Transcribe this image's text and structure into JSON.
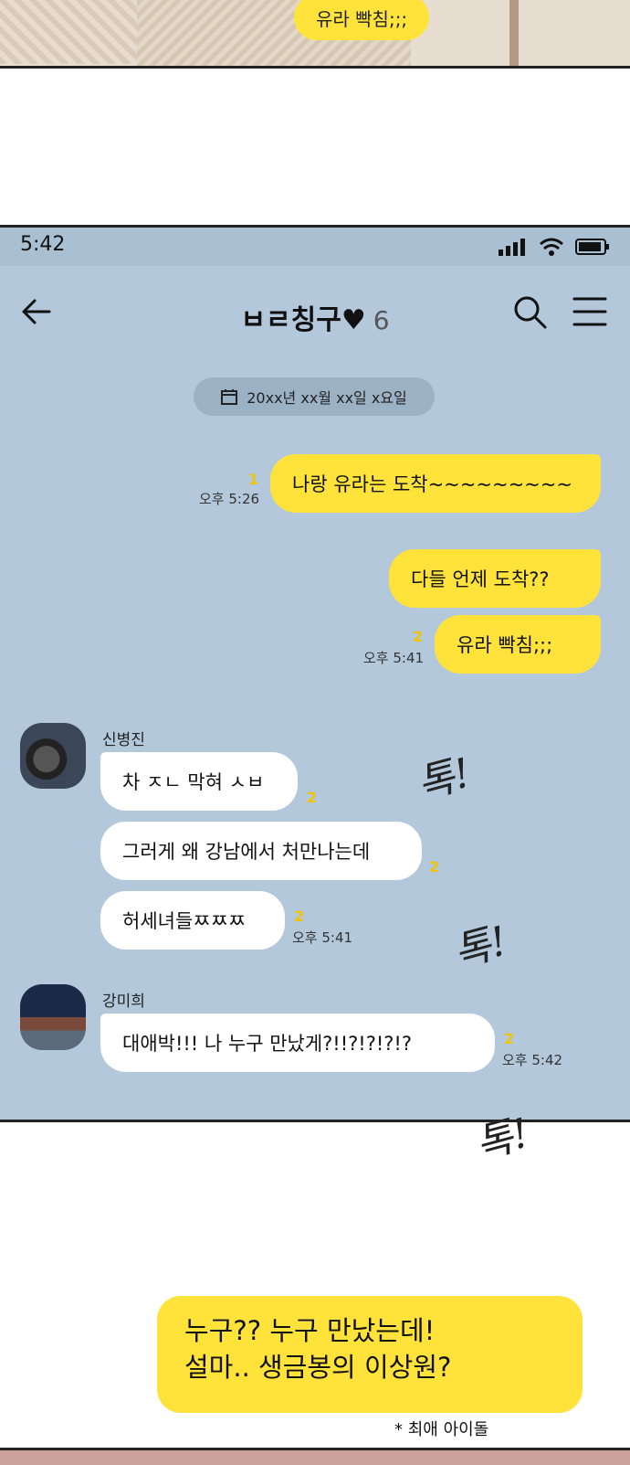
{
  "top_panel": {
    "bubble_text": "유라 빡침;;;"
  },
  "status_bar": {
    "time": "5:42"
  },
  "chat": {
    "title": "ㅂㄹ칭구♥",
    "member_count": "6",
    "date_label": "20xx년 xx월 xx일 x요일",
    "messages_mine": [
      {
        "text": "나랑 유라는 도착~~~~~~~~~",
        "unread": "1",
        "time": "오후 5:26"
      },
      {
        "text": "다들 언제 도착??"
      },
      {
        "text": "유라 빡침;;;",
        "unread": "2",
        "time": "오후 5:41"
      }
    ],
    "group1": {
      "sender": "신병진",
      "messages": [
        {
          "text": "차 ㅈㄴ 막혀 ㅅㅂ",
          "unread": "2"
        },
        {
          "text": "그러게 왜 강남에서 처만나는데",
          "unread": "2"
        },
        {
          "text": "허세녀들ㅉㅉㅉ",
          "unread": "2",
          "time": "오후 5:41"
        }
      ]
    },
    "group2": {
      "sender": "강미희",
      "messages": [
        {
          "text": "대애박!!! 나 누구 만났게?!!?!?!?!?",
          "unread": "2",
          "time": "오후 5:42"
        }
      ]
    }
  },
  "sfx": [
    "톡!",
    "톡!",
    "톡!"
  ],
  "bottom": {
    "speech_line1": "누구?? 누구 만났는데!",
    "speech_line2": "설마.. 생금봉의 이상원?",
    "footnote": "* 최애 아이돌"
  },
  "colors": {
    "chat_bg": "#b3c8db",
    "my_bubble": "#ffe33a",
    "their_bubble": "#ffffff",
    "unread": "#f2c400"
  }
}
